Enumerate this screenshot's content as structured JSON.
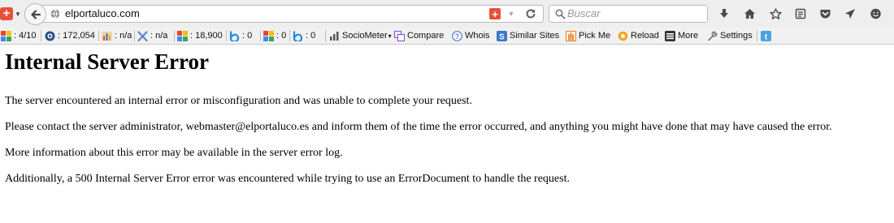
{
  "browser": {
    "url": "elportaluco.com",
    "search_placeholder": "Buscar"
  },
  "toolbar": {
    "google_pagerank": ": 4/10",
    "alexa_rank": ": 172,054",
    "bookmark_count": ": n/a",
    "delicious_count": ": n/a",
    "google_index": ": 18,900",
    "bing_index": ": 0",
    "google_backlinks": ": 0",
    "bing_backlinks": ": 0",
    "sociometer_label": "SocioMeter",
    "compare_label": "Compare",
    "whois_label": "Whois",
    "similar_sites_label": "Similar Sites",
    "pick_me_label": "Pick Me",
    "reload_label": "Reload",
    "more_label": "More",
    "settings_label": "Settings"
  },
  "page": {
    "title": "Internal Server Error",
    "paragraphs": [
      "The server encountered an internal error or misconfiguration and was unable to complete your request.",
      "Please contact the server administrator, webmaster@elportaluco.es and inform them of the time the error occurred, and anything you might have done that may have caused the error.",
      "More information about this error may be available in the server error log.",
      "Additionally, a 500 Internal Server Error error was encountered while trying to use an ErrorDocument to handle the request."
    ]
  },
  "colors": {
    "addon_red": "#e8503a",
    "google_green": "#34a853",
    "bing_blue": "#1e88e5",
    "twitter_blue": "#4aa3df"
  }
}
